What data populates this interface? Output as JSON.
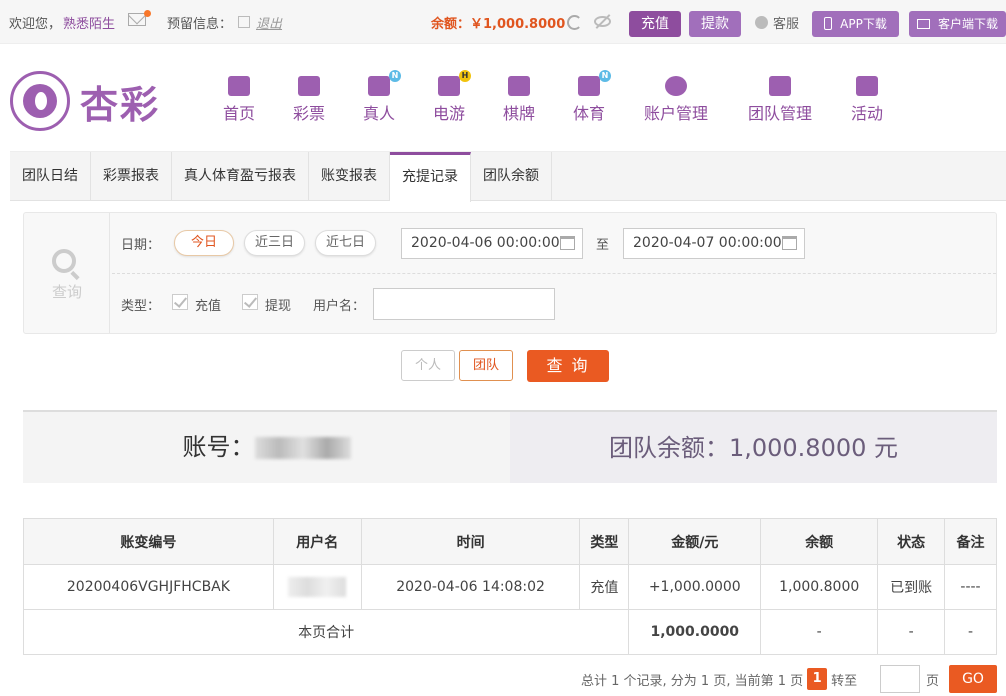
{
  "topbar": {
    "welcome": "欢迎您，",
    "username": "熟悉陌生",
    "reserve_label": "预留信息：",
    "logout": "退出",
    "balance": "余额：￥1,000.8000",
    "recharge": "充值",
    "withdraw": "提款",
    "service": "客服",
    "app_download": "APP下载",
    "client_download": "客户端下载"
  },
  "logo": {
    "text": "杏彩"
  },
  "nav": [
    {
      "label": "首页",
      "icon": "home-icon",
      "badge": ""
    },
    {
      "label": "彩票",
      "icon": "lottery-icon",
      "badge": ""
    },
    {
      "label": "真人",
      "icon": "live-icon",
      "badge": "N"
    },
    {
      "label": "电游",
      "icon": "gamepad-icon",
      "badge": "H"
    },
    {
      "label": "棋牌",
      "icon": "cards-icon",
      "badge": ""
    },
    {
      "label": "体育",
      "icon": "trophy-icon",
      "badge": "N"
    },
    {
      "label": "账户管理",
      "icon": "yen-icon",
      "badge": ""
    },
    {
      "label": "团队管理",
      "icon": "team-icon",
      "badge": ""
    },
    {
      "label": "活动",
      "icon": "gift-icon",
      "badge": ""
    }
  ],
  "subtabs": [
    "团队日结",
    "彩票报表",
    "真人体育盈亏报表",
    "账变报表",
    "充提记录",
    "团队余额"
  ],
  "query": {
    "side_label": "查询",
    "date_label": "日期：",
    "ranges": [
      "今日",
      "近三日",
      "近七日"
    ],
    "start_date": "2020-04-06 00:00:00",
    "to_label": "至",
    "end_date": "2020-04-07 00:00:00",
    "type_label": "类型：",
    "type_recharge": "充值",
    "type_withdraw": "提现",
    "username_label": "用户名：",
    "username_value": "",
    "personal": "个人",
    "team": "团队",
    "submit": "查 询"
  },
  "summary": {
    "account_label": "账号：",
    "team_balance": "团队余额：1,000.8000 元"
  },
  "table": {
    "headers": [
      "账变编号",
      "用户名",
      "时间",
      "类型",
      "金额/元",
      "余额",
      "状态",
      "备注"
    ],
    "rows": [
      {
        "id": "20200406VGHJFHCBAK",
        "time": "2020-04-06 14:08:02",
        "type": "充值",
        "amount": "+1,000.0000",
        "balance": "1,000.8000",
        "status": "已到账",
        "note": "----"
      }
    ],
    "total_label": "本页合计",
    "total_amount": "1,000.0000",
    "total_balance": "-",
    "total_status": "-",
    "total_note": "-"
  },
  "pager": {
    "summary": "总计 1 个记录, 分为 1 页, 当前第 1 页",
    "current": "1",
    "goto_label": "转至",
    "page_label": "页",
    "go": "GO"
  },
  "colors": {
    "brand": "#8e4d9e",
    "accent": "#ea5a22",
    "success": "#3a9a2a"
  }
}
